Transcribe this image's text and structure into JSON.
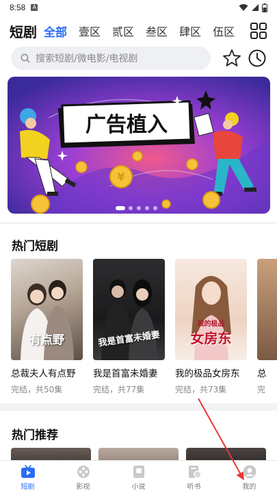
{
  "status": {
    "time": "8:58",
    "badge": "A"
  },
  "header": {
    "title": "短剧",
    "categories": [
      "全部",
      "壹区",
      "贰区",
      "叁区",
      "肆区",
      "伍区"
    ],
    "active_category": "全部"
  },
  "search": {
    "placeholder": "搜索短剧/微电影/电视剧"
  },
  "banner": {
    "text": "广告植入",
    "dots": 5,
    "active_dot": 0
  },
  "hot_dramas": {
    "title": "热门短剧",
    "items": [
      {
        "name": "总裁夫人有点野",
        "meta": "完结，共50集",
        "poster_text": "有点野"
      },
      {
        "name": "我是首富未婚妻",
        "meta": "完结，共77集",
        "poster_text": "我是首富未婚妻"
      },
      {
        "name": "我的极品女房东",
        "meta": "完结，共73集",
        "poster_text": "女房东",
        "poster_subtext": "我的极品"
      },
      {
        "name": "总",
        "meta": "完"
      }
    ]
  },
  "recommend": {
    "title": "热门推荐"
  },
  "bottom_nav": {
    "tabs": [
      {
        "label": "短剧",
        "icon": "tv-icon",
        "active": true
      },
      {
        "label": "影视",
        "icon": "film-reel-icon",
        "active": false
      },
      {
        "label": "小说",
        "icon": "book-icon",
        "active": false
      },
      {
        "label": "听书",
        "icon": "headphone-book-icon",
        "active": false
      },
      {
        "label": "我的",
        "icon": "user-icon",
        "active": false
      }
    ]
  },
  "colors": {
    "accent": "#2a6df4",
    "background": "#f2f3f5"
  }
}
